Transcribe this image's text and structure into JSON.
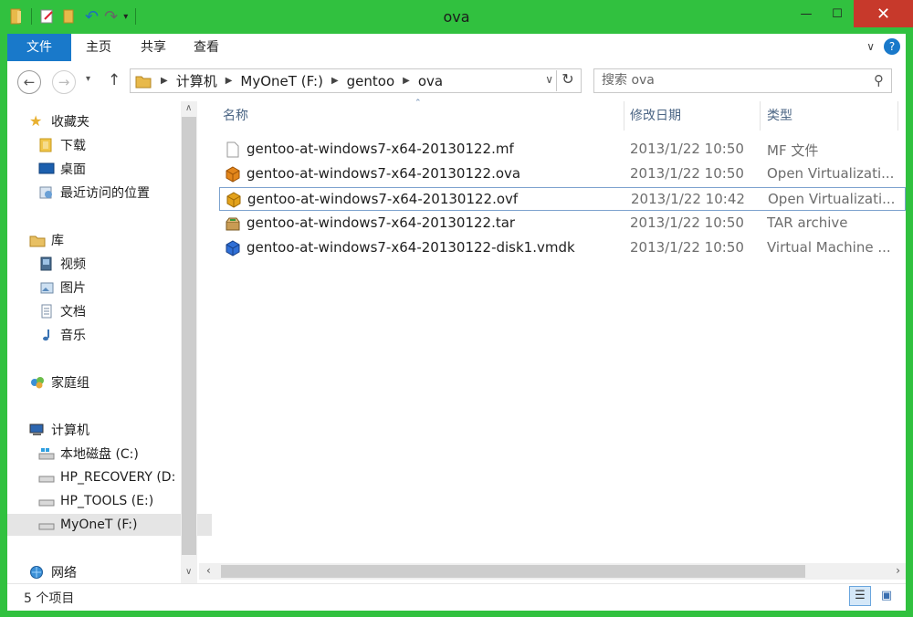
{
  "window": {
    "title": "ova"
  },
  "ribbon": {
    "tabs": [
      "文件",
      "主页",
      "共享",
      "查看"
    ]
  },
  "address": {
    "crumbs": [
      "计算机",
      "MyOneT (F:)",
      "gentoo",
      "ova"
    ],
    "search_placeholder": "搜索 ova"
  },
  "sidebar": {
    "favorites": {
      "label": "收藏夹",
      "items": [
        "下载",
        "桌面",
        "最近访问的位置"
      ]
    },
    "libraries": {
      "label": "库",
      "items": [
        "视频",
        "图片",
        "文档",
        "音乐"
      ]
    },
    "homegroup": {
      "label": "家庭组"
    },
    "computer": {
      "label": "计算机",
      "items": [
        "本地磁盘 (C:)",
        "HP_RECOVERY (D:",
        "HP_TOOLS (E:)",
        "MyOneT (F:)"
      ]
    },
    "network": {
      "label": "网络"
    }
  },
  "columns": {
    "name": "名称",
    "date": "修改日期",
    "type": "类型"
  },
  "files": [
    {
      "name": "gentoo-at-windows7-x64-20130122.mf",
      "date": "2013/1/22 10:50",
      "type": "MF 文件",
      "icon": "blank-file-icon"
    },
    {
      "name": "gentoo-at-windows7-x64-20130122.ova",
      "date": "2013/1/22 10:50",
      "type": "Open Virtualizati...",
      "icon": "virtualbox-icon"
    },
    {
      "name": "gentoo-at-windows7-x64-20130122.ovf",
      "date": "2013/1/22 10:42",
      "type": "Open Virtualizati...",
      "icon": "virtualbox-icon"
    },
    {
      "name": "gentoo-at-windows7-x64-20130122.tar",
      "date": "2013/1/22 10:50",
      "type": "TAR archive",
      "icon": "archive-icon"
    },
    {
      "name": "gentoo-at-windows7-x64-20130122-disk1.vmdk",
      "date": "2013/1/22 10:50",
      "type": "Virtual Machine ...",
      "icon": "vmdk-icon"
    }
  ],
  "status": {
    "count": "5 个项目"
  },
  "colors": {
    "frame": "#31c13f",
    "file_tab": "#1979ca",
    "close": "#c7392b"
  }
}
